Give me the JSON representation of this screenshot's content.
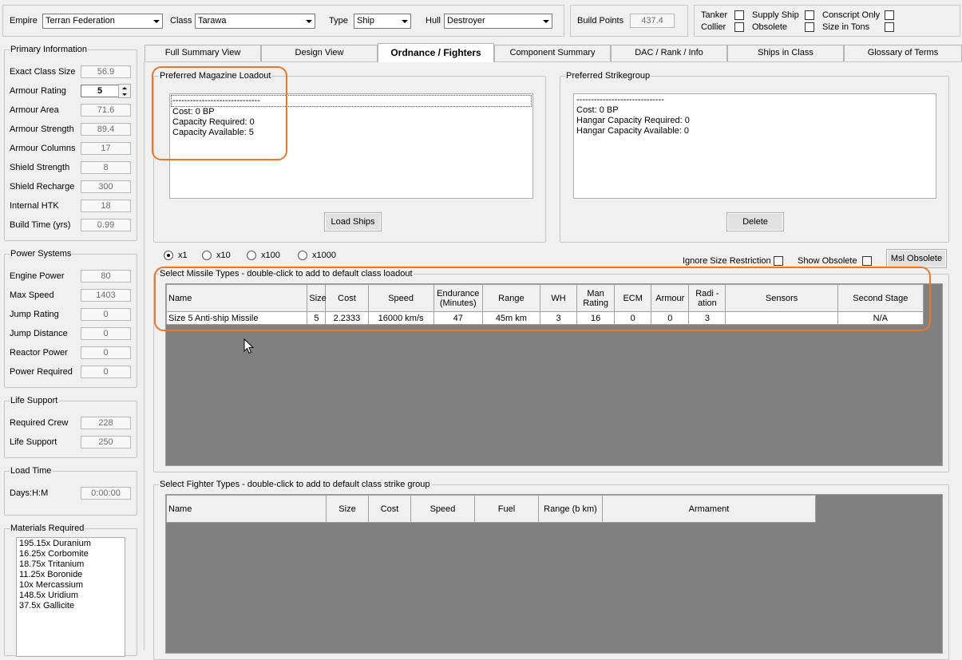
{
  "top": {
    "empire_label": "Empire",
    "empire_value": "Terran Federation",
    "class_label": "Class",
    "class_value": "Tarawa",
    "type_label": "Type",
    "type_value": "Ship",
    "hull_label": "Hull",
    "hull_value": "Destroyer",
    "build_points_label": "Build Points",
    "build_points_value": "437.4",
    "checkboxes": [
      {
        "label": "Tanker"
      },
      {
        "label": "Supply Ship"
      },
      {
        "label": "Conscript Only"
      },
      {
        "label": "Collier"
      },
      {
        "label": "Obsolete"
      },
      {
        "label": "Size in Tons"
      }
    ]
  },
  "primary": {
    "title": "Primary Information",
    "rows": [
      {
        "label": "Exact Class Size",
        "value": "56.9"
      },
      {
        "label": "Armour Rating",
        "value": "5"
      },
      {
        "label": "Armour Area",
        "value": "71.6"
      },
      {
        "label": "Armour Strength",
        "value": "89.4"
      },
      {
        "label": "Armour Columns",
        "value": "17"
      },
      {
        "label": "Shield Strength",
        "value": "8"
      },
      {
        "label": "Shield Recharge",
        "value": "300"
      },
      {
        "label": "Internal HTK",
        "value": "18"
      },
      {
        "label": "Build Time (yrs)",
        "value": "0.99"
      }
    ]
  },
  "power": {
    "title": "Power Systems",
    "rows": [
      {
        "label": "Engine Power",
        "value": "80"
      },
      {
        "label": "Max Speed",
        "value": "1403"
      },
      {
        "label": "Jump Rating",
        "value": "0"
      },
      {
        "label": "Jump Distance",
        "value": "0"
      },
      {
        "label": "Reactor Power",
        "value": "0"
      },
      {
        "label": "Power Required",
        "value": "0"
      }
    ]
  },
  "life": {
    "title": "Life Support",
    "rows": [
      {
        "label": "Required Crew",
        "value": "228"
      },
      {
        "label": "Life Support",
        "value": "250"
      }
    ]
  },
  "load": {
    "title": "Load Time",
    "rows": [
      {
        "label": "Days:H:M",
        "value": "0:00:00"
      }
    ]
  },
  "materials": {
    "title": "Materials Required",
    "items": [
      "195.15x Duranium",
      "16.25x Corbomite",
      "18.75x Tritanium",
      "11.25x Boronide",
      "10x Mercassium",
      "148.5x Uridium",
      "37.5x Gallicite"
    ]
  },
  "tabs": [
    {
      "label": "Full Summary View"
    },
    {
      "label": "Design View"
    },
    {
      "label": "Ordnance / Fighters"
    },
    {
      "label": "Component Summary"
    },
    {
      "label": "DAC / Rank / Info"
    },
    {
      "label": "Ships in Class"
    },
    {
      "label": "Glossary of Terms"
    }
  ],
  "magazine": {
    "title": "Preferred Magazine Loadout",
    "selected_line": "------------------------------",
    "lines": [
      "Cost: 0 BP",
      "Capacity Required: 0",
      "Capacity Available: 5"
    ],
    "button": "Load Ships"
  },
  "strike": {
    "title": "Preferred Strikegroup",
    "lines": [
      "------------------------------",
      "Cost: 0 BP",
      "Hangar Capacity Required: 0",
      "Hangar Capacity Available: 0"
    ],
    "button": "Delete"
  },
  "multipliers": [
    {
      "label": "x1",
      "selected": true
    },
    {
      "label": "x10",
      "selected": false
    },
    {
      "label": "x100",
      "selected": false
    },
    {
      "label": "x1000",
      "selected": false
    }
  ],
  "options": {
    "ignore_size": "Ignore Size Restriction",
    "show_obsolete": "Show Obsolete",
    "msl_obsolete": "Msl Obsolete"
  },
  "missiles": {
    "title": "Select Missile Types - double-click to add to default class loadout",
    "headers": [
      "Name",
      "Size",
      "Cost",
      "Speed",
      "Endurance (Minutes)",
      "Range",
      "WH",
      "Man Rating",
      "ECM",
      "Armour",
      "Radi -ation",
      "Sensors",
      "Second Stage"
    ],
    "rows": [
      [
        "Size 5 Anti-ship Missile",
        "5",
        "2.2333",
        "16000 km/s",
        "47",
        "45m km",
        "3",
        "16",
        "0",
        "0",
        "3",
        "",
        "N/A"
      ]
    ]
  },
  "fighters": {
    "title": "Select Fighter Types - double-click to add to default class strike group",
    "headers": [
      "Name",
      "Size",
      "Cost",
      "Speed",
      "Fuel",
      "Range (b km)",
      "Armament"
    ]
  }
}
